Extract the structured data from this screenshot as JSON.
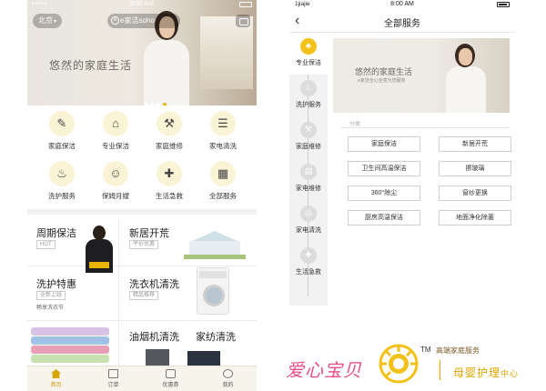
{
  "left": {
    "status": {
      "time": "8:00 AM"
    },
    "city": "北京",
    "search_text": "e家洁soho",
    "hero_title": "悠然的家庭生活",
    "services": [
      {
        "label": "家庭保洁",
        "icon": "broom-icon",
        "glyph": "✎"
      },
      {
        "label": "专业保洁",
        "icon": "vacuum-icon",
        "glyph": "⌂"
      },
      {
        "label": "家庭维修",
        "icon": "wrench-icon",
        "glyph": "⚒"
      },
      {
        "label": "家电清洗",
        "icon": "air-conditioner-icon",
        "glyph": "☰"
      },
      {
        "label": "洗护服务",
        "icon": "shirt-icon",
        "glyph": "♨"
      },
      {
        "label": "保姆月嫂",
        "icon": "nanny-icon",
        "glyph": "☺"
      },
      {
        "label": "生活急救",
        "icon": "first-aid-icon",
        "glyph": "✚"
      },
      {
        "label": "全部服务",
        "icon": "grid-icon",
        "glyph": "▦"
      }
    ],
    "promos": {
      "weekly_title": "周期保洁",
      "weekly_tag": "HOT",
      "newhome_title": "新居开荒",
      "newhome_tag": "平价优惠",
      "laundry_title": "洗护特惠",
      "laundry_tag": "全新上线",
      "laundry_sub": "畅享洗衣节",
      "washer_title": "洗衣机清洗",
      "washer_tag": "精品推荐",
      "hood_title": "油烟机清洗",
      "textile_title": "家纺清洗"
    },
    "tabs": [
      {
        "label": "首页",
        "icon": "home-icon"
      },
      {
        "label": "订单",
        "icon": "order-icon"
      },
      {
        "label": "优惠券",
        "icon": "coupon-icon"
      },
      {
        "label": "我的",
        "icon": "profile-icon"
      }
    ]
  },
  "right": {
    "status": {
      "carrier": "1jiajie",
      "time": "8:00 AM"
    },
    "title": "全部服务",
    "back_glyph": "‹",
    "sidebar": [
      {
        "label": "专业保洁",
        "icon": "spray-icon",
        "glyph": "♣"
      },
      {
        "label": "洗护服务",
        "icon": "shirt-icon",
        "glyph": "♨"
      },
      {
        "label": "家庭维修",
        "icon": "wrench-icon",
        "glyph": "⚒"
      },
      {
        "label": "家电维修",
        "icon": "appliance-icon",
        "glyph": "▤"
      },
      {
        "label": "家电清洗",
        "icon": "washer-icon",
        "glyph": "◎"
      },
      {
        "label": "生活急救",
        "icon": "first-aid-icon",
        "glyph": "✚"
      }
    ],
    "banner_title": "悠然的家庭生活",
    "banner_sub": "e家洁全心全意为您服务",
    "category_label": "分类",
    "service_buttons": [
      "家庭保洁",
      "新居开荒",
      "卫生间高温保洁",
      "擦玻璃",
      "360°除尘",
      "窗纱更换",
      "厨房高温保洁",
      "地面净化除菌"
    ]
  },
  "brand": {
    "name": "爱心宝贝",
    "tm": "TM",
    "tagline": "高端家庭服务",
    "sub_main": "母婴护理",
    "sub_small": "中心"
  },
  "colors": {
    "accent": "#f3c21a",
    "pink": "#e8508a",
    "gold": "#e1a400"
  }
}
